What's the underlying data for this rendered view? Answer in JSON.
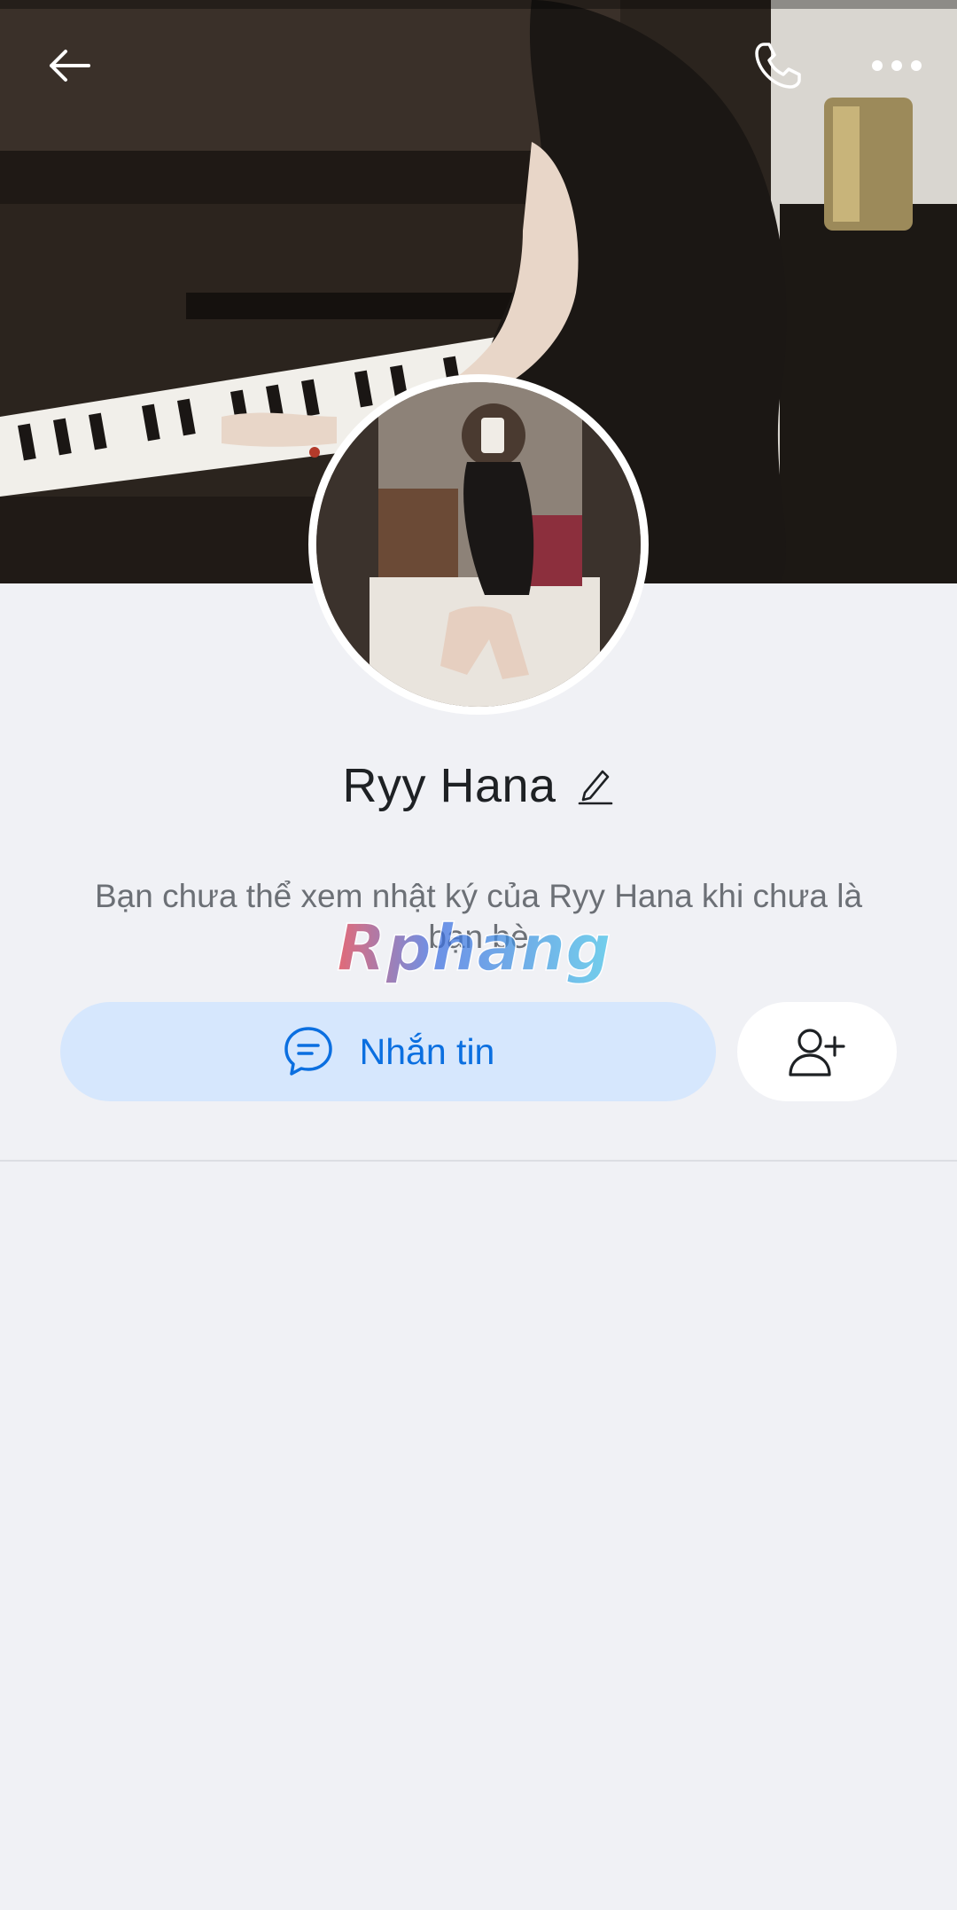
{
  "profile": {
    "name": "Ryy Hana",
    "notice": "Bạn chưa thể xem nhật ký của Ryy Hana khi chưa là bạn bè"
  },
  "actions": {
    "message_label": "Nhắn tin"
  },
  "watermark": {
    "text": "Rphang"
  },
  "icons": {
    "back": "arrow-left-icon",
    "call": "phone-icon",
    "more": "more-dots-icon",
    "edit": "pencil-icon",
    "message": "chat-bubble-icon",
    "add_friend": "user-plus-icon"
  },
  "colors": {
    "background": "#f0f1f5",
    "message_button_bg": "#d6e7fd",
    "message_button_text": "#0b6fe0",
    "name_text": "#1e2124",
    "notice_text": "#6c7076"
  }
}
